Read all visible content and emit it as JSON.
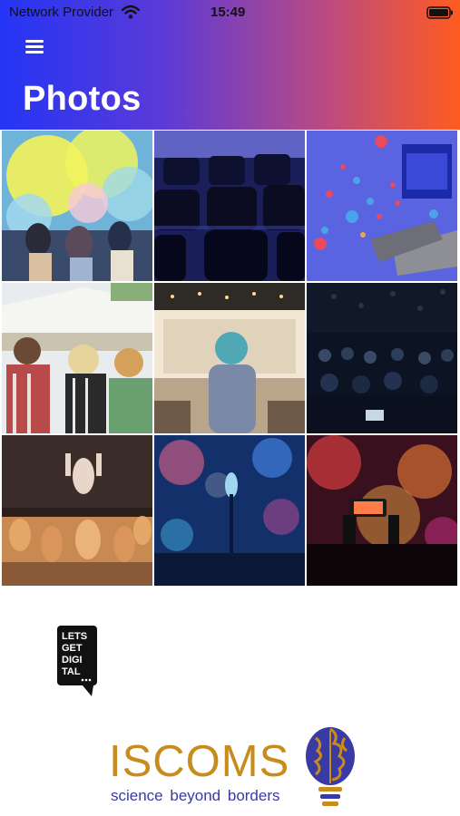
{
  "status_bar": {
    "provider": "Network Provider",
    "time": "15:49",
    "icons": [
      "wifi-icon",
      "battery-icon"
    ]
  },
  "header": {
    "title": "Photos",
    "menu_icon": "hamburger-menu-icon",
    "gradient": [
      "#2435f5",
      "#ff5b1f"
    ]
  },
  "photos": [
    {
      "id": "photo-holi-festival",
      "subject": "holi color festival"
    },
    {
      "id": "photo-auditorium-seats",
      "subject": "empty auditorium chairs"
    },
    {
      "id": "photo-social-stage",
      "subject": "stage with floating like hearts"
    },
    {
      "id": "photo-outdoor-crowd",
      "subject": "outdoor festival crowd"
    },
    {
      "id": "photo-conference-speaker",
      "subject": "speaker at conference"
    },
    {
      "id": "photo-dark-audience",
      "subject": "audience in dark hall"
    },
    {
      "id": "photo-concert-hands",
      "subject": "concert crowd hands"
    },
    {
      "id": "photo-microphone-stage",
      "subject": "microphone on blue stage"
    },
    {
      "id": "photo-phone-concert",
      "subject": "phone filming concert"
    }
  ],
  "logos": {
    "lets_get_digital": [
      "LETS",
      "GET",
      "DIGI",
      "TAL"
    ],
    "iscoms_name": "ISCOMS",
    "iscoms_tagline": "science beyond borders"
  },
  "colors": {
    "iscoms_gold": "#c88c1c",
    "iscoms_blue": "#3a3aa5"
  }
}
